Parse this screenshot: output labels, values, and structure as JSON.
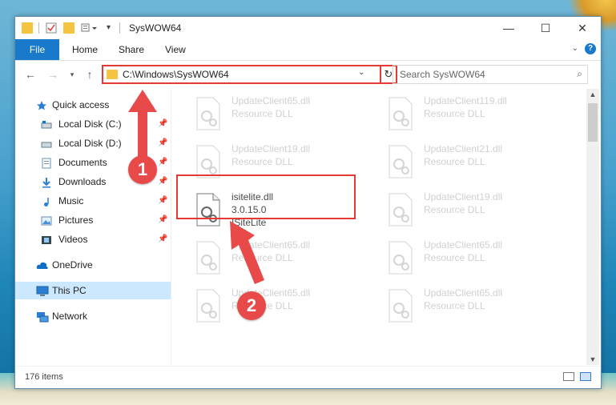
{
  "window": {
    "title": "SysWOW64",
    "controls": {
      "minimize": "—",
      "maximize": "☐",
      "close": "✕"
    }
  },
  "ribbon": {
    "tabs": [
      "File",
      "Home",
      "Share",
      "View"
    ],
    "help": "?"
  },
  "address_bar": {
    "path": "C:\\Windows\\SysWOW64"
  },
  "search": {
    "placeholder": "Search SysWOW64"
  },
  "sidebar": {
    "items": [
      {
        "label": "Quick access",
        "icon": "star-icon"
      },
      {
        "label": "Local Disk (C:)",
        "icon": "drive-icon",
        "pinned": true
      },
      {
        "label": "Local Disk (D:)",
        "icon": "drive-icon",
        "pinned": true
      },
      {
        "label": "Documents",
        "icon": "documents-icon",
        "pinned": true
      },
      {
        "label": "Downloads",
        "icon": "downloads-icon",
        "pinned": true
      },
      {
        "label": "Music",
        "icon": "music-icon",
        "pinned": true
      },
      {
        "label": "Pictures",
        "icon": "pictures-icon",
        "pinned": true
      },
      {
        "label": "Videos",
        "icon": "videos-icon",
        "pinned": true
      },
      {
        "label": "OneDrive",
        "icon": "cloud-icon"
      },
      {
        "label": "This PC",
        "icon": "computer-icon",
        "selected": true
      },
      {
        "label": "Network",
        "icon": "network-icon"
      }
    ]
  },
  "files": [
    {
      "name": "UpdateClient65.dll",
      "sub": "Resource DLL"
    },
    {
      "name": "UpdateClient119.dll",
      "sub": "Resource DLL"
    },
    {
      "name": "UpdateClient19.dll",
      "sub": "Resource DLL"
    },
    {
      "name": "UpdateClient21.dll",
      "sub": "Resource DLL"
    },
    {
      "name": "isitelite.dll",
      "sub": "3.0.15.0",
      "sub2": "ISiteLite",
      "highlighted": true
    },
    {
      "name": "UpdateClient19.dll",
      "sub": "Resource DLL"
    },
    {
      "name": "UpdateClient65.dll",
      "sub": "Resource DLL"
    },
    {
      "name": "UpdateClient65.dll",
      "sub": "Resource DLL"
    },
    {
      "name": "UpdateClient65.dll",
      "sub": "Resource DLL"
    },
    {
      "name": "UpdateClient65.dll",
      "sub": "Resource DLL"
    }
  ],
  "status": {
    "item_count": "176 items"
  },
  "annotations": {
    "step1": "1",
    "step2": "2",
    "color": "#e84a4a"
  }
}
